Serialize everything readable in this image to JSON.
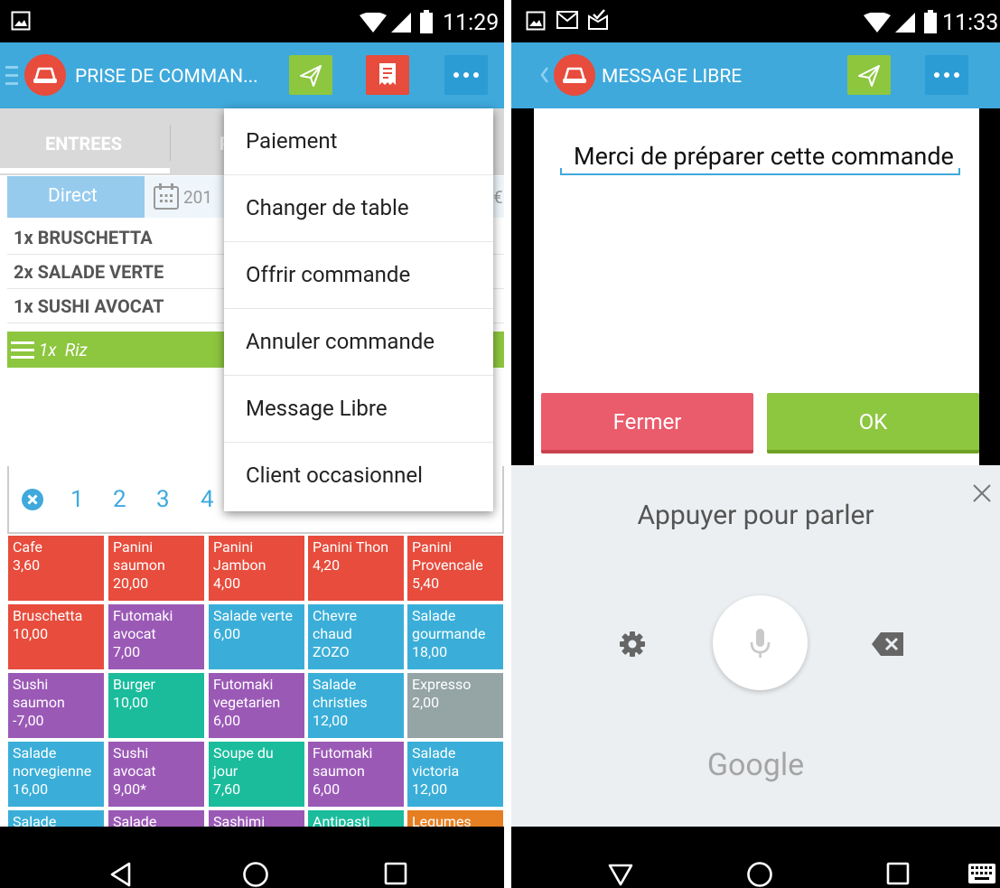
{
  "left": {
    "status": {
      "time": "11:29"
    },
    "appbar": {
      "title": "PRISE DE COMMAN..."
    },
    "tabs": {
      "active": "ENTREES",
      "partial": "P"
    },
    "order_bar": {
      "mode": "Direct",
      "date_partial": "201",
      "currency_partial": "€"
    },
    "order_items": [
      "1x  BRUSCHETTA",
      "2x  SALADE VERTE",
      "1x  SUSHI AVOCAT"
    ],
    "selected_item": "1x  Riz",
    "keypad": [
      "1",
      "2",
      "3",
      "4"
    ],
    "menu": [
      "Paiement",
      "Changer de table",
      "Offrir commande",
      "Annuler commande",
      "Message Libre",
      "Client occasionnel"
    ],
    "tiles": [
      {
        "lines": [
          "Cafe",
          "3,60"
        ],
        "color": "#e74c3c"
      },
      {
        "lines": [
          "Panini",
          "saumon",
          "20,00"
        ],
        "color": "#e74c3c"
      },
      {
        "lines": [
          "Panini",
          "Jambon",
          "4,00"
        ],
        "color": "#e74c3c"
      },
      {
        "lines": [
          "Panini Thon",
          "4,20"
        ],
        "color": "#e74c3c"
      },
      {
        "lines": [
          "Panini",
          "Provencale",
          "5,40"
        ],
        "color": "#e74c3c"
      },
      {
        "lines": [
          "Bruschetta",
          "10,00"
        ],
        "color": "#e74c3c"
      },
      {
        "lines": [
          "Futomaki",
          "avocat",
          "7,00"
        ],
        "color": "#9b59b6"
      },
      {
        "lines": [
          "Salade verte",
          "6,00"
        ],
        "color": "#3aaed8"
      },
      {
        "lines": [
          "Chevre",
          "chaud",
          "ZOZO"
        ],
        "color": "#3aaed8"
      },
      {
        "lines": [
          "Salade",
          "gourmande",
          "18,00"
        ],
        "color": "#3aaed8"
      },
      {
        "lines": [
          "Sushi",
          "saumon",
          "-7,00"
        ],
        "color": "#9b59b6"
      },
      {
        "lines": [
          "Burger",
          "10,00"
        ],
        "color": "#1abc9c"
      },
      {
        "lines": [
          "Futomaki",
          "vegetarien",
          "6,00"
        ],
        "color": "#9b59b6"
      },
      {
        "lines": [
          "Salade",
          "christies",
          "12,00"
        ],
        "color": "#3aaed8"
      },
      {
        "lines": [
          "Expresso",
          "2,00"
        ],
        "color": "#95a5a6"
      },
      {
        "lines": [
          "Salade",
          "norvegienne",
          "16,00"
        ],
        "color": "#3aaed8"
      },
      {
        "lines": [
          "Sushi",
          "avocat",
          "9,00*"
        ],
        "color": "#9b59b6"
      },
      {
        "lines": [
          "Soupe du",
          "jour",
          "7,60"
        ],
        "color": "#1abc9c"
      },
      {
        "lines": [
          "Futomaki",
          "saumon",
          "6,00"
        ],
        "color": "#9b59b6"
      },
      {
        "lines": [
          "Salade",
          "victoria",
          "12,00"
        ],
        "color": "#3aaed8"
      },
      {
        "lines": [
          "Salade"
        ],
        "color": "#3aaed8"
      },
      {
        "lines": [
          "Salade"
        ],
        "color": "#9b59b6"
      },
      {
        "lines": [
          "Sashimi"
        ],
        "color": "#9b59b6"
      },
      {
        "lines": [
          "Antipasti"
        ],
        "color": "#1abc9c"
      },
      {
        "lines": [
          "Legumes"
        ],
        "color": "#e67e22"
      }
    ]
  },
  "right": {
    "status": {
      "time": "11:33"
    },
    "appbar": {
      "title": "MESSAGE LIBRE"
    },
    "message": "Merci de préparer cette commande",
    "buttons": {
      "close": "Fermer",
      "ok": "OK"
    },
    "voice": {
      "prompt": "Appuyer pour parler",
      "brand": "Google"
    }
  }
}
